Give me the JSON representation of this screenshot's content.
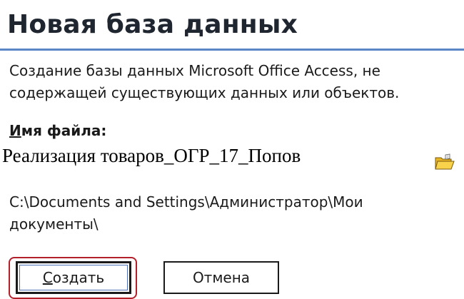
{
  "dialog": {
    "title": "Новая база данных",
    "description": "Создание базы данных Microsoft Office Access, не содержащей существующих данных или объектов.",
    "filename_label_accel": "И",
    "filename_label_rest": "мя файла:",
    "filename_value": "Реализация товаров_ОГР_17_Попов",
    "save_path": "C:\\Documents and Settings\\Администратор\\Мои документы\\",
    "create_button_accel": "С",
    "create_button_rest": "оздать",
    "cancel_button": "Отмена"
  },
  "icons": {
    "browse": "open-folder-icon"
  },
  "colors": {
    "title_rule": "#5a86c6",
    "focus_ring": "#b3202a",
    "folder_yellow": "#f2c230"
  }
}
